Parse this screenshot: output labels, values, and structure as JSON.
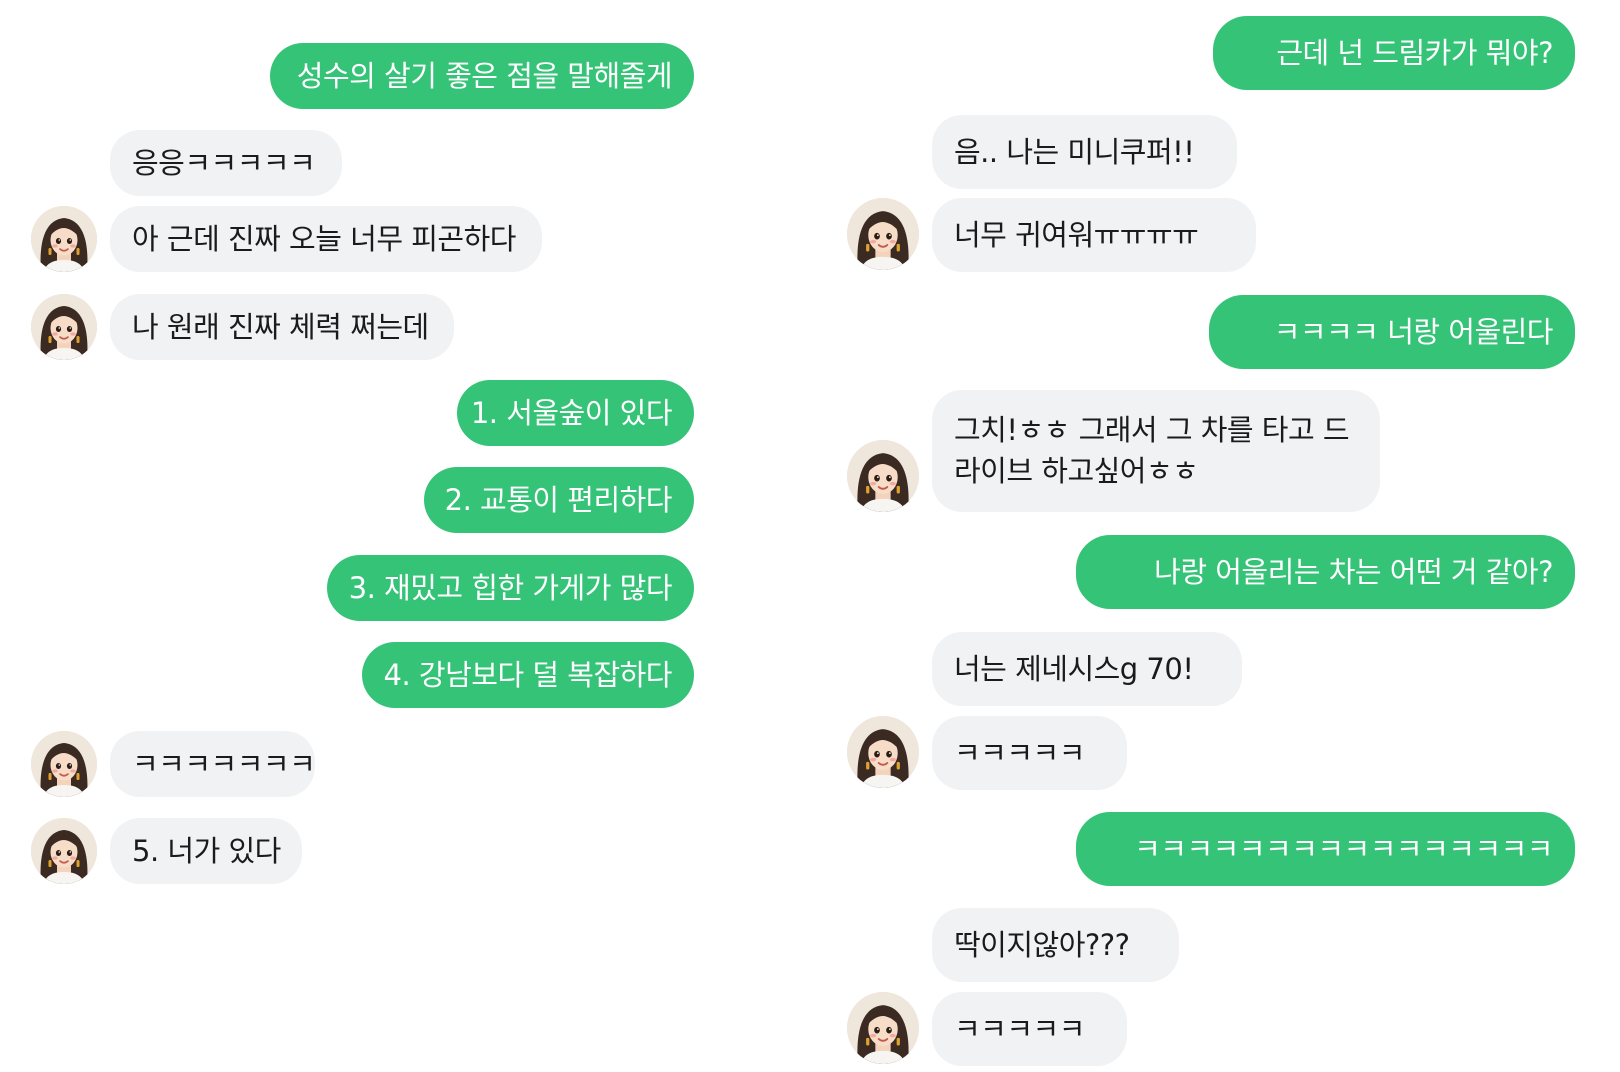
{
  "left_chat": {
    "messages": [
      {
        "sender": "me",
        "text": "성수의 살기 좋은 점을 말해줄게"
      },
      {
        "sender": "them",
        "text": "응응ㅋㅋㅋㅋㅋ"
      },
      {
        "sender": "them",
        "text": "아 근데 진짜 오늘 너무 피곤하다"
      },
      {
        "sender": "them",
        "text": "나 원래 진짜 체력 쩌는데"
      },
      {
        "sender": "me",
        "text": "1. 서울숲이 있다"
      },
      {
        "sender": "me",
        "text": "2. 교통이 편리하다"
      },
      {
        "sender": "me",
        "text": "3. 재밌고 힙한 가게가 많다"
      },
      {
        "sender": "me",
        "text": "4. 강남보다 덜 복잡하다"
      },
      {
        "sender": "them",
        "text": "ㅋㅋㅋㅋㅋㅋㅋ"
      },
      {
        "sender": "them",
        "text": "5. 너가 있다"
      }
    ]
  },
  "right_chat": {
    "messages": [
      {
        "sender": "me",
        "text": "근데 넌 드림카가 뭐야?"
      },
      {
        "sender": "them",
        "text": "음.. 나는 미니쿠퍼!!"
      },
      {
        "sender": "them",
        "text": "너무 귀여워ㅠㅠㅠㅠ"
      },
      {
        "sender": "me",
        "text": "ㅋㅋㅋㅋ 너랑 어울린다"
      },
      {
        "sender": "them",
        "text": "그치!ㅎㅎ 그래서 그 차를 타고 드라이브 하고싶어ㅎㅎ"
      },
      {
        "sender": "me",
        "text": "나랑 어울리는 차는 어떤 거 같아?"
      },
      {
        "sender": "them",
        "text": "너는 제네시스g 70!"
      },
      {
        "sender": "them",
        "text": "ㅋㅋㅋㅋㅋ"
      },
      {
        "sender": "me",
        "text": "ㅋㅋㅋㅋㅋㅋㅋㅋㅋㅋㅋㅋㅋㅋㅋㅋ"
      },
      {
        "sender": "them",
        "text": "딱이지않아???"
      },
      {
        "sender": "them",
        "text": "ㅋㅋㅋㅋㅋ"
      }
    ]
  },
  "colors": {
    "sent_bubble": "#35c378",
    "received_bubble": "#f1f2f4",
    "sent_text": "#ffffff",
    "received_text": "#1b1b1b"
  },
  "avatar_icon": "girl-avatar-icon"
}
